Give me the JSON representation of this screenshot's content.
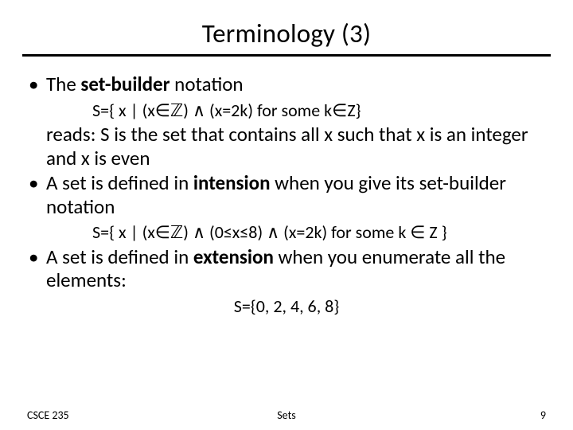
{
  "title": "Terminology (3)",
  "bullets": {
    "b1_pre": "The ",
    "b1_bold": "set-builder",
    "b1_post": " notation",
    "formula1": "S={ x | (x∈ℤ) ∧ (x=2k) for some k∈Z}",
    "reads": "reads: S is the set that contains all x such that x is an integer and x is even",
    "b2_pre": "A set is defined in ",
    "b2_bold": "intension",
    "b2_post": " when you give its set-builder notation",
    "formula2": "S={ x | (x∈ℤ) ∧ (0≤x≤8) ∧ (x=2k) for some k ∈ Z }",
    "b3_pre": "A set is defined in ",
    "b3_bold": "extension",
    "b3_post": " when you enumerate all the elements:",
    "formula3": "S={0, 2, 4, 6, 8}"
  },
  "footer": {
    "left": "CSCE 235",
    "center": "Sets",
    "right": "9"
  }
}
